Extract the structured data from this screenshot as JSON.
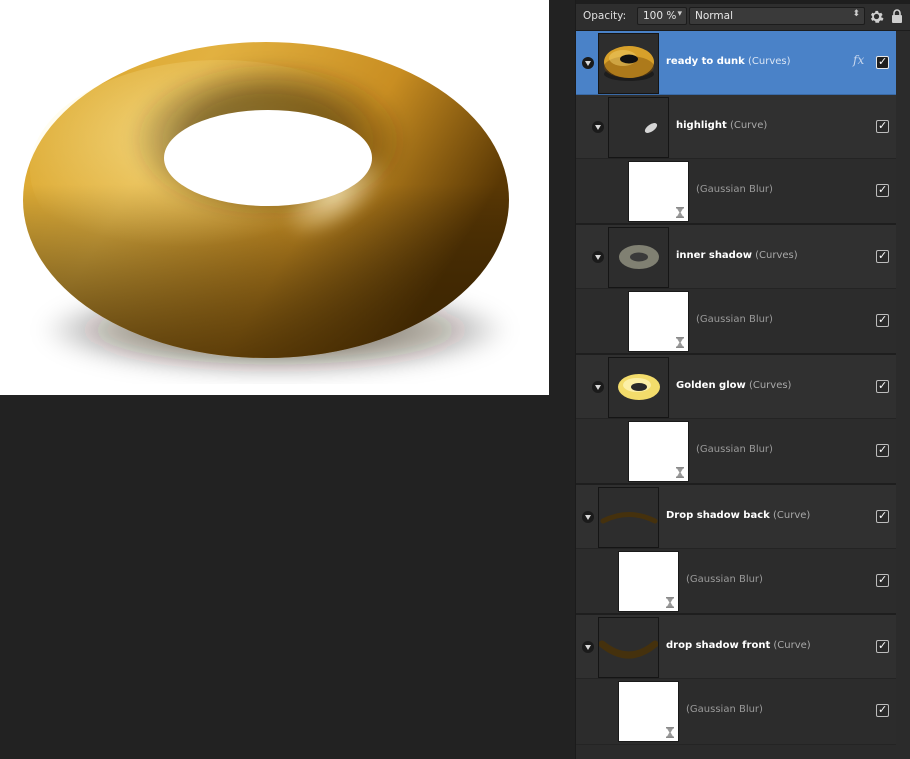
{
  "toolbar": {
    "opacity_label": "Opacity:",
    "opacity_value": "100 %",
    "blend_mode": "Normal",
    "settings_icon": "gear-icon",
    "lock_icon": "lock-icon"
  },
  "colors": {
    "selection": "#4a82c8",
    "panel_bg": "#2b2b2b",
    "donut_gold": "#e0a93a",
    "donut_shadow": "#4a2f05"
  },
  "layers": [
    {
      "name": "ready to dunk",
      "type": "(Curves)",
      "visible": true,
      "selected": true,
      "has_fx": true,
      "fx_label": "fx",
      "thumbnail": "golden donut"
    },
    {
      "name": "highlight",
      "type": "(Curve)",
      "visible": true,
      "thumbnail": "white highlight stroke"
    },
    {
      "name": "",
      "type": "(Gaussian Blur)",
      "visible": true,
      "thumbnail": "live filter"
    },
    {
      "name": "inner shadow",
      "type": "(Curves)",
      "visible": true,
      "thumbnail": "grey ring"
    },
    {
      "name": "",
      "type": "(Gaussian Blur)",
      "visible": true,
      "thumbnail": "live filter"
    },
    {
      "name": "Golden glow",
      "type": "(Curves)",
      "visible": true,
      "thumbnail": "yellow ring"
    },
    {
      "name": "",
      "type": "(Gaussian Blur)",
      "visible": true,
      "thumbnail": "live filter"
    },
    {
      "name": "Drop shadow back",
      "type": "(Curve)",
      "visible": true,
      "thumbnail": "brown arc"
    },
    {
      "name": "",
      "type": "(Gaussian Blur)",
      "visible": true,
      "thumbnail": "live filter"
    },
    {
      "name": "drop shadow front",
      "type": "(Curve)",
      "visible": true,
      "thumbnail": "brown arc"
    },
    {
      "name": "",
      "type": "(Gaussian Blur)",
      "visible": true,
      "thumbnail": "live filter"
    }
  ]
}
